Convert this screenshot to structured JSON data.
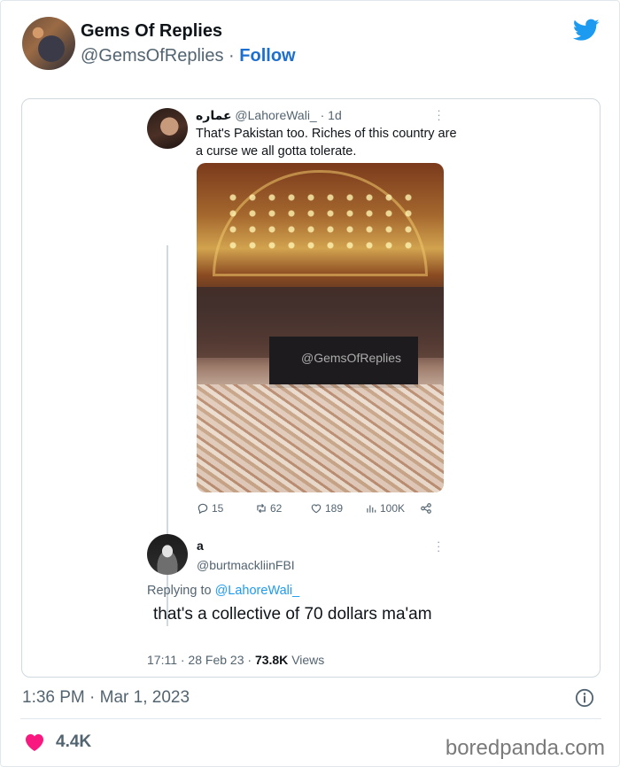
{
  "post": {
    "author_name": "Gems Of Replies",
    "author_handle": "@GemsOfReplies",
    "separator": "·",
    "follow_label": "Follow",
    "timestamp": "1:36 PM · Mar 1, 2023",
    "likes": "4.4K",
    "icons": {
      "logo": "twitter-bird-icon",
      "info": "info-icon",
      "like": "heart-icon"
    },
    "colors": {
      "twitter_blue": "#1d9bf0",
      "follow_blue": "#1d6fcf",
      "heart": "#f91880"
    }
  },
  "quoted": {
    "name": "عماره",
    "handle": "@LahoreWali_",
    "age": "1d",
    "text": "That's Pakistan too. Riches of this country are a curse we all gotta tolerate.",
    "image_watermark": "@GemsOfReplies",
    "metrics": {
      "replies": "15",
      "retweets": "62",
      "likes": "189",
      "views": "100K"
    }
  },
  "reply": {
    "name": "a",
    "handle": "@burtmackliinFBI",
    "replying_prefix": "Replying to",
    "replying_to": "@LahoreWali_",
    "text": "that's a collective of 70 dollars ma'am",
    "time": "17:11 · 28 Feb 23 ·",
    "views_count": "73.8K",
    "views_label": "Views"
  },
  "brand": "boredpanda.com"
}
